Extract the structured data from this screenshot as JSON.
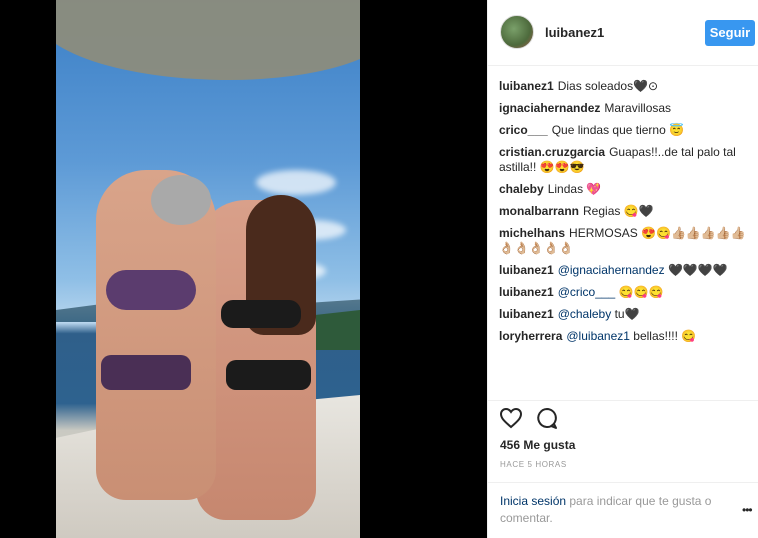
{
  "post": {
    "username": "luibanez1",
    "follow_label": "Seguir"
  },
  "comments": [
    {
      "user": "luibanez1",
      "text": "Dias soleados",
      "emoji": "🖤⊙"
    },
    {
      "user": "ignaciahernandez",
      "text": "Maravillosas",
      "emoji": ""
    },
    {
      "user": "crico___",
      "text": "Que lindas que tierno",
      "emoji": "😇"
    },
    {
      "user": "cristian.cruzgarcia",
      "text": "Guapas!!..de tal palo tal astilla!!",
      "emoji": "😍😍😎"
    },
    {
      "user": "chaleby",
      "text": "Lindas",
      "emoji": "💖"
    },
    {
      "user": "monalbarrann",
      "text": "Regias",
      "emoji": "😋🖤"
    },
    {
      "user": "michelhans",
      "text": "HERMOSAS",
      "emoji": "😍😋👍🏼👍🏼👍🏼👍🏼👍🏼👌🏼👌🏼👌🏼👌🏼👌🏼"
    },
    {
      "user": "luibanez1",
      "mention": "@ignaciahernandez",
      "text": "",
      "emoji": "🖤🖤🖤🖤"
    },
    {
      "user": "luibanez1",
      "mention": "@crico___",
      "text": "",
      "emoji": "😋😋😋"
    },
    {
      "user": "luibanez1",
      "mention": "@chaleby",
      "text": "tu",
      "emoji": "🖤"
    },
    {
      "user": "loryherrera",
      "mention": "@luibanez1",
      "text": "bellas!!!!",
      "emoji": "😋"
    }
  ],
  "icons": {
    "like": "heart-icon",
    "comment": "comment-icon",
    "more": "more-options-icon"
  },
  "stats": {
    "likes": "456 Me gusta",
    "time": "HACE 5 HORAS"
  },
  "login": {
    "link": "Inicia sesión",
    "text": " para indicar que te gusta o comentar.",
    "more": "•••"
  }
}
